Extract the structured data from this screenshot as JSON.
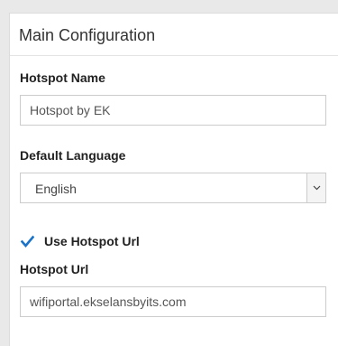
{
  "panel": {
    "title": "Main Configuration",
    "hotspot_name": {
      "label": "Hotspot Name",
      "value": "Hotspot by EK"
    },
    "default_language": {
      "label": "Default Language",
      "selected": "English"
    },
    "use_hotspot_url": {
      "label": "Use Hotspot Url",
      "checked": true
    },
    "hotspot_url": {
      "label": "Hotspot Url",
      "value": "wifiportal.ekselansbyits.com"
    }
  },
  "colors": {
    "accent": "#1a73c8"
  },
  "icons": {
    "checkbox": "checkmark-icon",
    "dropdown": "chevron-down-icon"
  }
}
